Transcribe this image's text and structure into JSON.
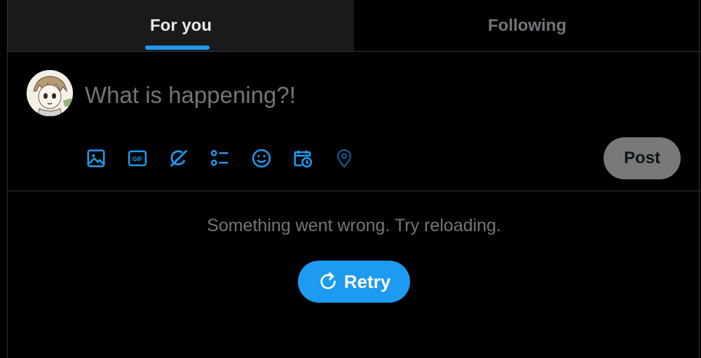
{
  "tabs": [
    {
      "label": "For you",
      "active": true
    },
    {
      "label": "Following",
      "active": false
    }
  ],
  "composer": {
    "placeholder": "What is happening?!",
    "post_label": "Post",
    "tools": [
      "image-icon",
      "gif-icon",
      "grok-icon",
      "poll-icon",
      "emoji-icon",
      "schedule-icon",
      "location-icon"
    ]
  },
  "feed": {
    "error_text": "Something went wrong. Try reloading.",
    "retry_label": "Retry"
  },
  "colors": {
    "accent": "#1d9bf0",
    "background": "#000000",
    "border": "#2f3336",
    "muted_text": "#71767b",
    "post_button_disabled": "#787a7a"
  }
}
